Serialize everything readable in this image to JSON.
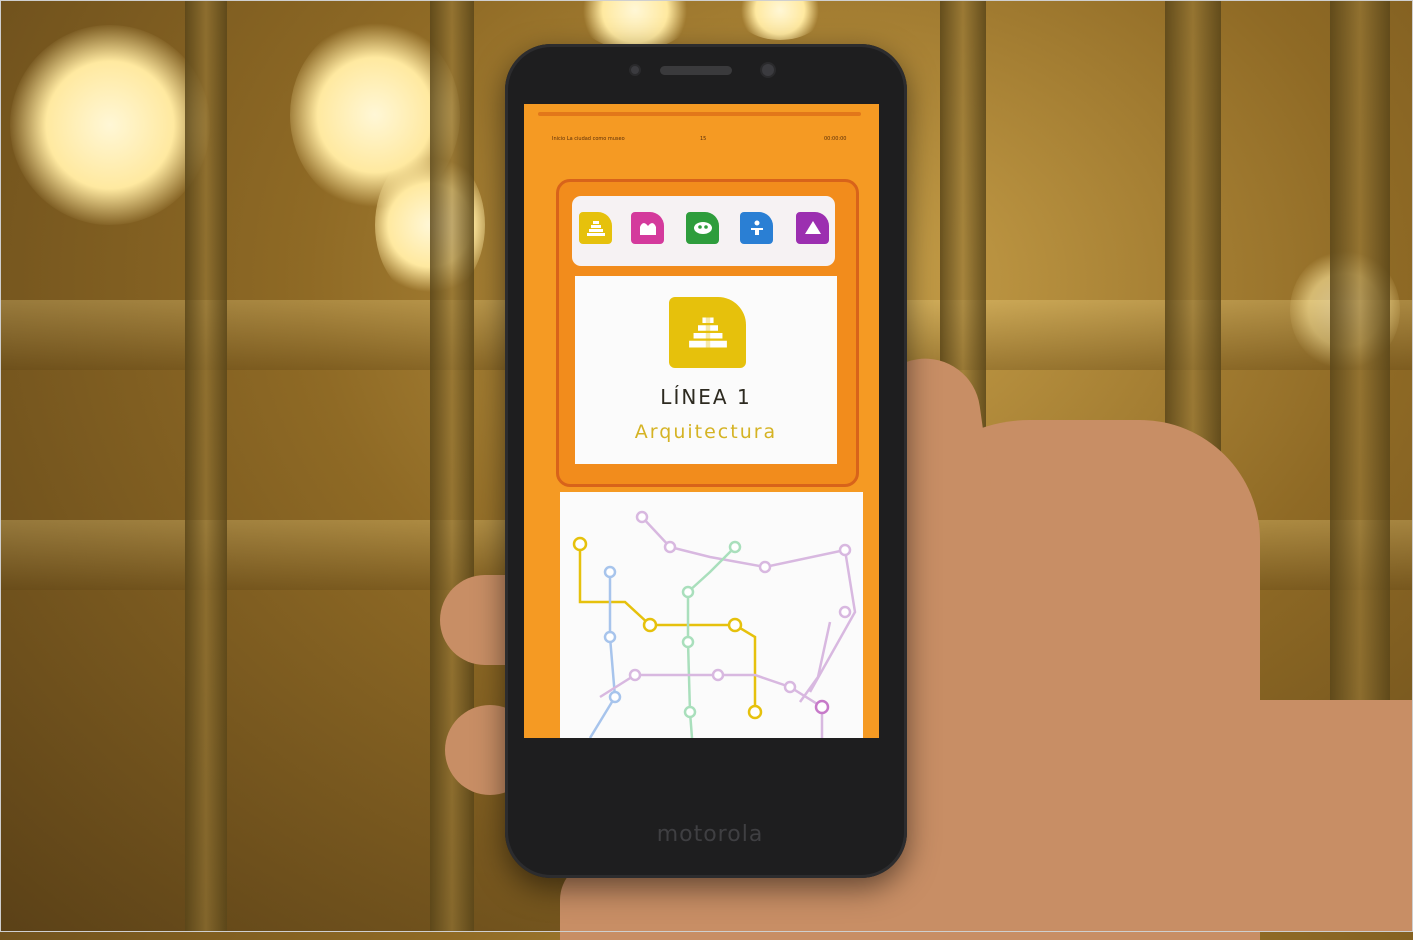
{
  "screen": {
    "status": {
      "left": "Inicio  La ciudad como museo",
      "center": "15",
      "right": "00:00:00"
    },
    "line_icons": [
      {
        "name": "line-1-icon",
        "color": "#e6c10c"
      },
      {
        "name": "line-2-icon",
        "color": "#d43a9c"
      },
      {
        "name": "line-3-icon",
        "color": "#2e9d3c"
      },
      {
        "name": "line-4-icon",
        "color": "#2a7fd4"
      },
      {
        "name": "line-5-icon",
        "color": "#9c2fb0"
      }
    ],
    "selected_line": {
      "title": "LÍNEA 1",
      "subtitle": "Arquitectura",
      "color": "#e6c10c"
    }
  },
  "phone": {
    "brand": "motorola"
  },
  "colors": {
    "screen_bg": "#f59a23",
    "panel_border": "#d8631a"
  }
}
